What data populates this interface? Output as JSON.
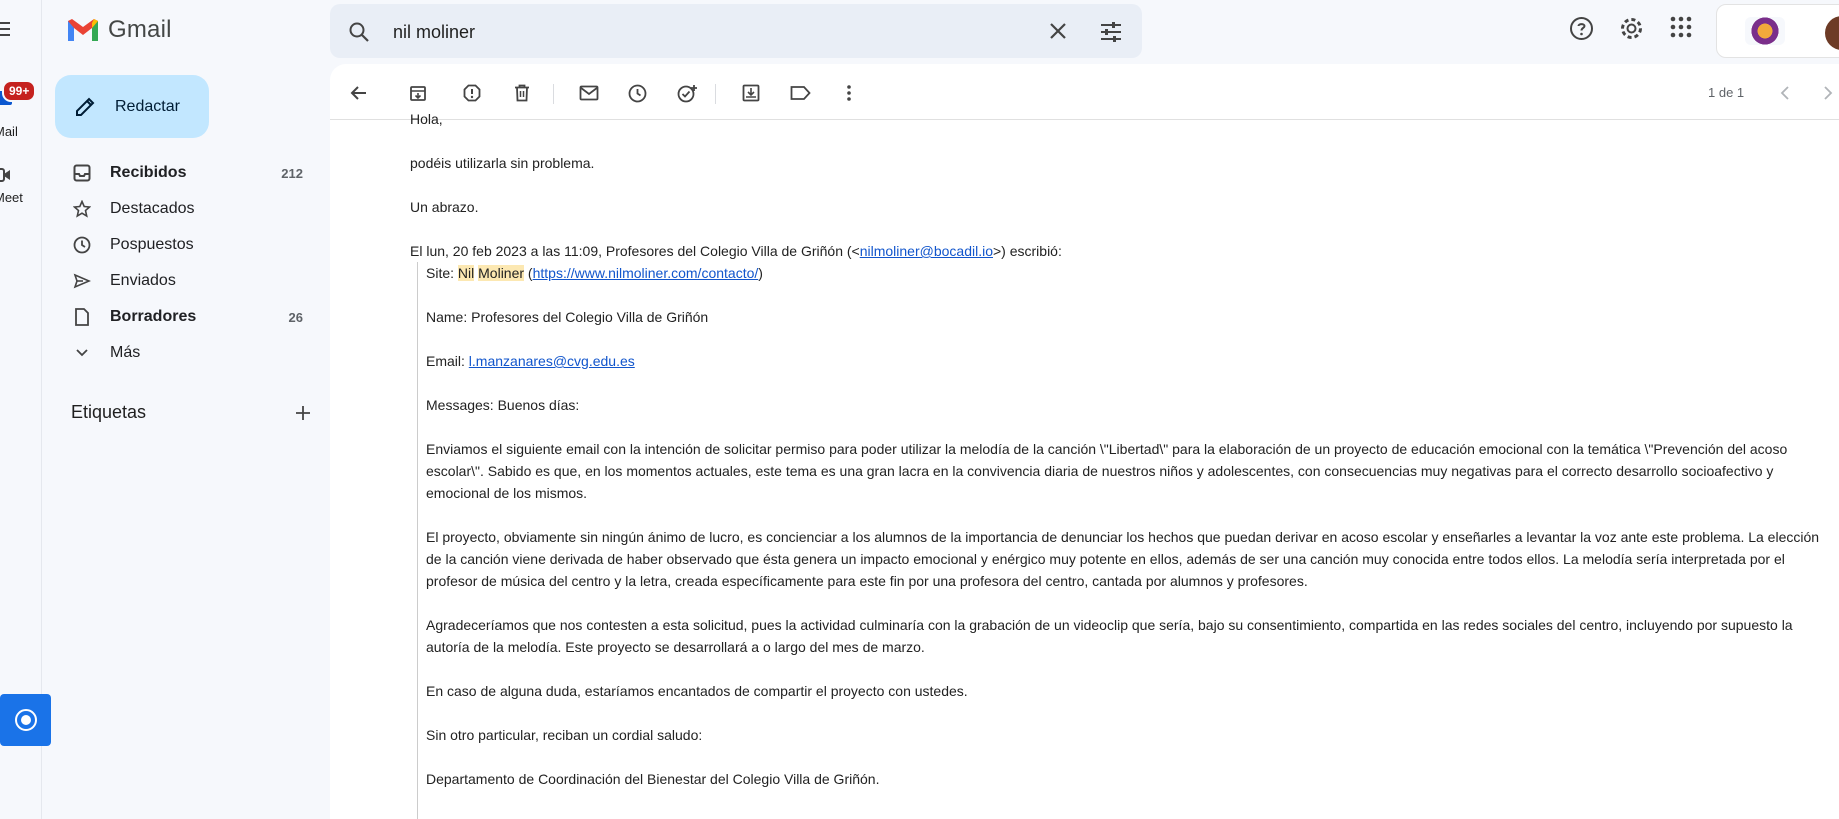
{
  "app": {
    "name": "Gmail"
  },
  "rail": {
    "badge": "99+",
    "mail_label": "Mail",
    "meet_label": "Meet"
  },
  "compose": {
    "label": "Redactar"
  },
  "nav": {
    "items": [
      {
        "label": "Recibidos",
        "count": "212",
        "icon": "inbox-icon"
      },
      {
        "label": "Destacados",
        "count": "",
        "icon": "star-icon"
      },
      {
        "label": "Pospuestos",
        "count": "",
        "icon": "clock-icon"
      },
      {
        "label": "Enviados",
        "count": "",
        "icon": "send-icon"
      },
      {
        "label": "Borradores",
        "count": "26",
        "icon": "draft-icon"
      },
      {
        "label": "Más",
        "count": "",
        "icon": "chevron-down-icon"
      }
    ]
  },
  "labels": {
    "heading": "Etiquetas"
  },
  "search": {
    "query": "nil moliner"
  },
  "toolbar": {
    "pager": "1 de 1"
  },
  "email": {
    "greeting": "Hola,",
    "line1": "podéis utilizarla sin problema.",
    "line2": "Un abrazo.",
    "attribution_pre": "El lun, 20 feb 2023 a las 11:09, Profesores del Colegio Villa de Griñón (<",
    "attribution_email": "nilmoliner@bocadil.io",
    "attribution_post": ">) escribió:",
    "site_label": "Site: ",
    "site_name_1": "Nil",
    "site_name_2": "Moliner",
    "site_url": "https://www.nilmoliner.com/contacto/",
    "name_line": "Name: Profesores del Colegio Villa de Griñón",
    "email_label": "Email: ",
    "email_value": "l.manzanares@cvg.edu.es",
    "messages_line": "Messages: Buenos días:",
    "para1": "Enviamos el siguiente email con la intención de solicitar permiso para poder utilizar la melodía de la canción \\\"Libertad\\\" para la elaboración de un proyecto de educación emocional con la temática \\\"Prevención del acoso escolar\\\". Sabido es que, en los momentos actuales, este tema es una gran lacra en la convivencia diaria de nuestros niños y adolescentes, con consecuencias muy negativas para el correcto desarrollo socioafectivo y emocional de los mismos.",
    "para2": "El proyecto, obviamente sin ningún ánimo de lucro, es concienciar a los alumnos de la importancia de denunciar los hechos que puedan derivar en acoso escolar y enseñarles a levantar la voz ante este problema. La elección de la canción viene derivada de haber observado que ésta genera un impacto emocional y enérgico muy potente en ellos, además de ser una canción muy conocida entre todos ellos. La melodía sería interpretada por el profesor de música del centro y la letra, creada específicamente para este fin por una profesora del centro, cantada por alumnos y profesores.",
    "para3": "Agradeceríamos que nos contesten a esta solicitud, pues la actividad culminaría con la grabación de un videoclip que sería, bajo su consentimiento, compartida en las redes sociales del centro, incluyendo por supuesto la autoría de la melodía. Este proyecto se desarrollará a o largo del mes de marzo.",
    "para4": "En caso de alguna duda, estaríamos encantados de compartir el proyecto con ustedes.",
    "para5": "Sin otro particular, reciban un cordial saludo:",
    "para6": "Departamento de Coordinación del Bienestar del Colegio Villa de Griñón."
  },
  "colors": {
    "compose_bg": "#c2e7ff",
    "highlight": "#fce8b2",
    "link": "#1155cc",
    "badge": "#c5221f"
  }
}
